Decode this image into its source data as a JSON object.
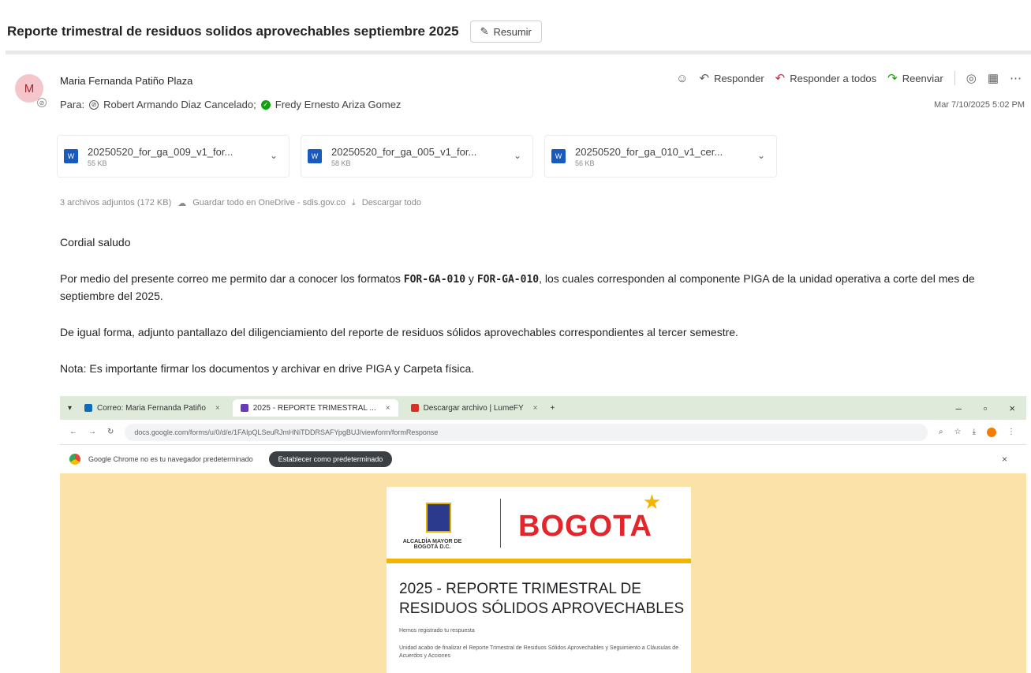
{
  "subject": "Reporte trimestral de residuos solidos aprovechables septiembre 2025",
  "summarize_label": "Resumir",
  "sender": {
    "avatar_initial": "M",
    "name": "Maria Fernanda Patiño Plaza",
    "to_label": "Para:",
    "recipients": [
      "Robert Armando Diaz Cancelado;",
      "Fredy Ernesto Ariza Gomez"
    ],
    "date": "Mar 7/10/2025 5:02 PM"
  },
  "actions": {
    "reply": "Responder",
    "reply_all": "Responder a todos",
    "forward": "Reenviar"
  },
  "attachments": [
    {
      "name": "20250520_for_ga_009_v1_for...",
      "size": "55 KB"
    },
    {
      "name": "20250520_for_ga_005_v1_for...",
      "size": "58 KB"
    },
    {
      "name": "20250520_for_ga_010_v1_cer...",
      "size": "56 KB"
    }
  ],
  "attachments_summary": {
    "count": "3 archivos adjuntos (172 KB)",
    "save_all": "Guardar todo en OneDrive - sdis.gov.co",
    "download_all": "Descargar todo"
  },
  "body": {
    "greeting": "Cordial saludo",
    "p1_start": "Por medio del presente correo me permito dar a conocer los formatos ",
    "p1_code1": "FOR-GA-010",
    "p1_mid": " y ",
    "p1_code2": "FOR-GA-010",
    "p1_end": ", los cuales corresponden al componente PIGA de la unidad operativa a corte del mes de septiembre del 2025.",
    "p2": "De igual forma, adjunto pantallazo del diligenciamiento del reporte de residuos sólidos aprovechables correspondientes al tercer semestre.",
    "p3": "Nota: Es importante firmar los documentos y archivar en drive PIGA y Carpeta física."
  },
  "screenshot": {
    "tabs": [
      "Correo: Maria Fernanda Patiño",
      "2025 - REPORTE TRIMESTRAL ...",
      "Descargar archivo | LumeFY"
    ],
    "url": "docs.google.com/forms/u/0/d/e/1FAIpQLSeuRJmHNiTDDRSAFYpgBUJ/viewform/formResponse",
    "infobar_text": "Google Chrome no es tu navegador predeterminado",
    "set_default": "Establecer como predeterminado",
    "alcaldia": "ALCALDÍA MAYOR DE BOGOTÁ D.C.",
    "bogota": "BOGOTA",
    "form_title": "2025 - REPORTE TRIMESTRAL DE RESIDUOS SÓLIDOS APROVECHABLES",
    "form_sub": "Hemos registrado tu respuesta",
    "form_desc": "Unidad acabo de finalizar el Reporte Trimestral de Residuos Sólidos Aprovechables y Seguimiento a Cláusulas de Acuerdos y Acciones"
  },
  "colors": {
    "accent": "#185abd",
    "form_bg": "#fbe2a8",
    "bogota_red": "#e3262b",
    "presence_green": "#13a10e"
  }
}
